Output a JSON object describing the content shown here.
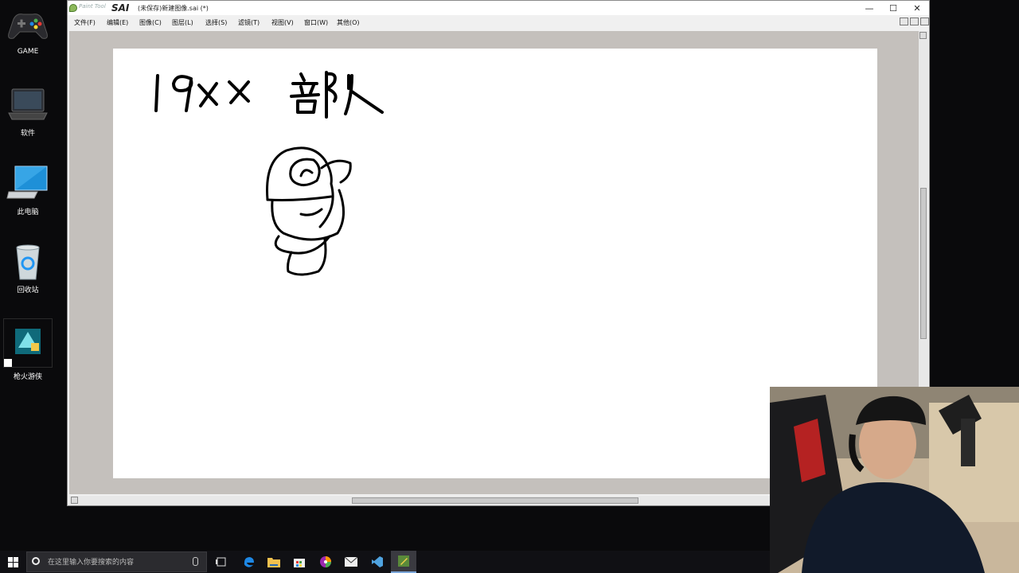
{
  "desktop": {
    "icons": [
      {
        "label": "GAME",
        "icon": "gamepad-icon"
      },
      {
        "label": "软件",
        "icon": "laptop-icon"
      },
      {
        "label": "此电脑",
        "icon": "computer-icon"
      },
      {
        "label": "回收站",
        "icon": "recycle-bin-icon"
      },
      {
        "label": "枪火游侠",
        "icon": "app-shortcut-icon"
      }
    ]
  },
  "sai": {
    "app_brand": "SAI",
    "app_brand_small": "Paint Tool",
    "title": "(未保存)新建图像.sai (*)",
    "window_controls": {
      "minimize": "—",
      "maximize": "☐",
      "close": "✕"
    },
    "menu": [
      "文件(F)",
      "编辑(E)",
      "图像(C)",
      "图层(L)",
      "选择(S)",
      "滤镜(T)",
      "视图(V)",
      "窗口(W)",
      "其他(O)"
    ],
    "canvas": {
      "handwritten_text": "19xx 部队",
      "drawing": "sketch-character-with-cap"
    }
  },
  "taskbar": {
    "search_placeholder": "在这里输入你要搜索的内容",
    "apps": [
      "task-view-icon",
      "edge-icon",
      "file-explorer-icon",
      "store-icon",
      "color-app-icon",
      "mail-icon",
      "visual-studio-icon",
      "sai-app-icon"
    ],
    "accent": "#7aa6d9"
  },
  "webcam": {
    "description_icon": "webcam-overlay"
  }
}
